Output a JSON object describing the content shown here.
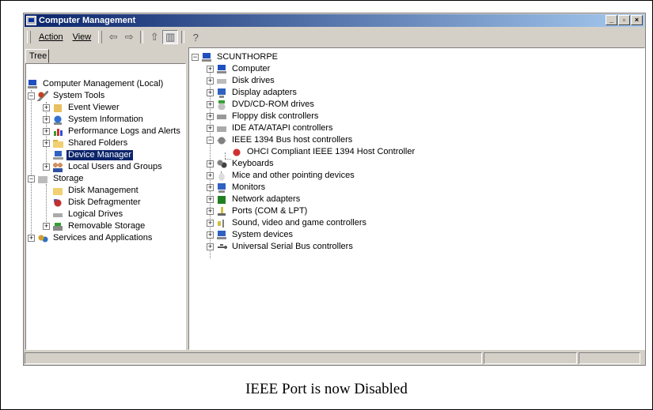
{
  "window": {
    "title": "Computer Management",
    "buttons": {
      "minimize": "_",
      "maximize": "▫",
      "close": "×"
    }
  },
  "menu": {
    "action": "Action",
    "view": "View"
  },
  "toolbar": {
    "back": "⇦",
    "forward": "⇨",
    "up": "⇧",
    "show_hide_tree": "▥",
    "help": "?"
  },
  "left_pane": {
    "tab": "Tree",
    "tree": [
      {
        "label": "Computer Management (Local)",
        "icon": "computer-icon",
        "level": 0
      },
      {
        "label": "System Tools",
        "icon": "tools-icon",
        "level": 1,
        "toggle": "−"
      },
      {
        "label": "Event Viewer",
        "icon": "event-viewer-icon",
        "level": 2,
        "toggle": "+"
      },
      {
        "label": "System Information",
        "icon": "system-info-icon",
        "level": 2,
        "toggle": "+"
      },
      {
        "label": "Performance Logs and Alerts",
        "icon": "performance-icon",
        "level": 2,
        "toggle": "+"
      },
      {
        "label": "Shared Folders",
        "icon": "folder-icon",
        "level": 2,
        "toggle": "+"
      },
      {
        "label": "Device Manager",
        "icon": "device-manager-icon",
        "level": 2,
        "selected": true
      },
      {
        "label": "Local Users and Groups",
        "icon": "users-icon",
        "level": 2,
        "toggle": "+"
      },
      {
        "label": "Storage",
        "icon": "storage-icon",
        "level": 1,
        "toggle": "−"
      },
      {
        "label": "Disk Management",
        "icon": "disk-management-icon",
        "level": 2
      },
      {
        "label": "Disk Defragmenter",
        "icon": "defragmenter-icon",
        "level": 2
      },
      {
        "label": "Logical Drives",
        "icon": "drive-icon",
        "level": 2
      },
      {
        "label": "Removable Storage",
        "icon": "removable-storage-icon",
        "level": 2,
        "toggle": "+"
      },
      {
        "label": "Services and Applications",
        "icon": "services-icon",
        "level": 1,
        "toggle": "+"
      }
    ]
  },
  "right_pane": {
    "root": "SCUNTHORPE",
    "root_toggle": "−",
    "devices": [
      {
        "label": "Computer",
        "icon": "computer-icon",
        "toggle": "+"
      },
      {
        "label": "Disk drives",
        "icon": "disk-drive-icon",
        "toggle": "+"
      },
      {
        "label": "Display adapters",
        "icon": "display-adapter-icon",
        "toggle": "+"
      },
      {
        "label": "DVD/CD-ROM drives",
        "icon": "dvd-icon",
        "toggle": "+"
      },
      {
        "label": "Floppy disk controllers",
        "icon": "floppy-icon",
        "toggle": "+"
      },
      {
        "label": "IDE ATA/ATAPI controllers",
        "icon": "ide-icon",
        "toggle": "+"
      },
      {
        "label": "IEEE 1394 Bus host controllers",
        "icon": "ieee1394-icon",
        "toggle": "−"
      },
      {
        "label": "OHCI Compliant IEEE 1394 Host Controller",
        "icon": "disabled-device-icon",
        "child": true
      },
      {
        "label": "Keyboards",
        "icon": "keyboard-icon",
        "toggle": "+"
      },
      {
        "label": "Mice and other pointing devices",
        "icon": "mouse-icon",
        "toggle": "+"
      },
      {
        "label": "Monitors",
        "icon": "monitor-icon",
        "toggle": "+"
      },
      {
        "label": "Network adapters",
        "icon": "network-adapter-icon",
        "toggle": "+"
      },
      {
        "label": "Ports (COM & LPT)",
        "icon": "ports-icon",
        "toggle": "+"
      },
      {
        "label": "Sound, video and game controllers",
        "icon": "sound-icon",
        "toggle": "+"
      },
      {
        "label": "System devices",
        "icon": "system-devices-icon",
        "toggle": "+"
      },
      {
        "label": "Universal Serial Bus controllers",
        "icon": "usb-icon",
        "toggle": "+"
      }
    ]
  },
  "caption": "IEEE Port is now Disabled"
}
